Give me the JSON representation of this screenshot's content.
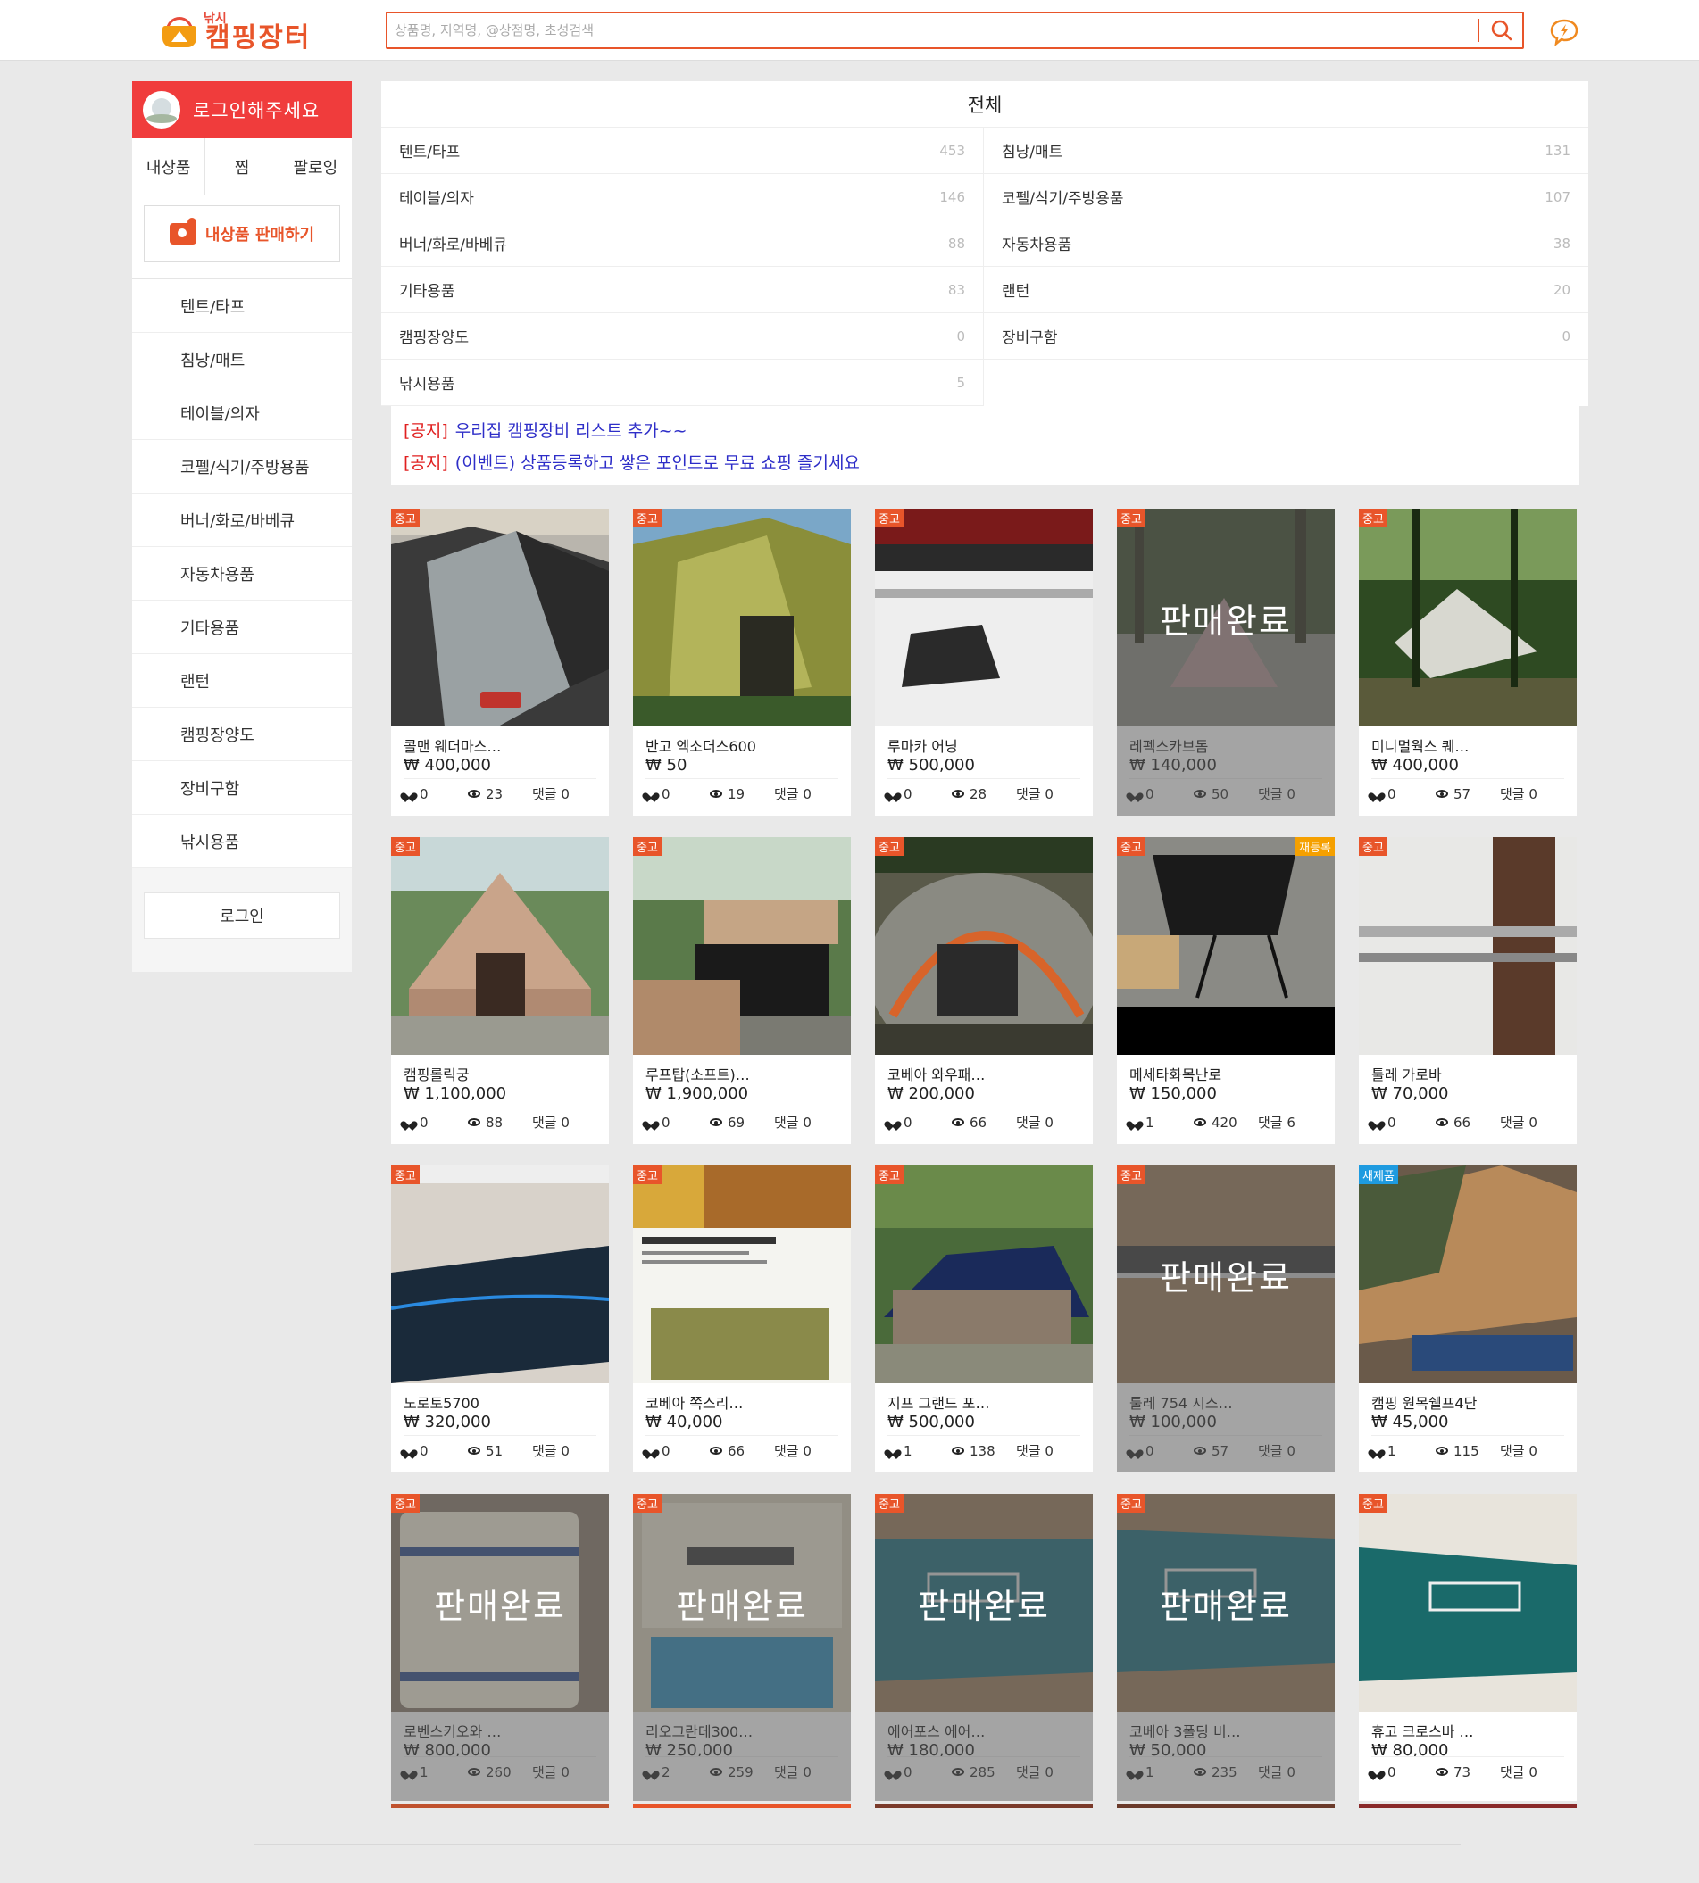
{
  "header": {
    "logo_small": "낚시",
    "logo_text": "캠핑장터",
    "search_placeholder": "상품명, 지역명, @상점명, 초성검색"
  },
  "sidebar": {
    "login_prompt": "로그인해주세요",
    "tabs": [
      "내상품",
      "찜",
      "팔로잉"
    ],
    "sell_button": "내상품 판매하기",
    "categories": [
      "텐트/타프",
      "침낭/매트",
      "테이블/의자",
      "코펠/식기/주방용품",
      "버너/화로/바베큐",
      "자동차용품",
      "기타용품",
      "랜턴",
      "캠핑장양도",
      "장비구함",
      "낚시용품"
    ],
    "login_button": "로그인"
  },
  "category_panel": {
    "title": "전체",
    "rows": [
      [
        {
          "name": "텐트/타프",
          "count": "453"
        },
        {
          "name": "침낭/매트",
          "count": "131"
        }
      ],
      [
        {
          "name": "테이블/의자",
          "count": "146"
        },
        {
          "name": "코펠/식기/주방용품",
          "count": "107"
        }
      ],
      [
        {
          "name": "버너/화로/바베큐",
          "count": "88"
        },
        {
          "name": "자동차용품",
          "count": "38"
        }
      ],
      [
        {
          "name": "기타용품",
          "count": "83"
        },
        {
          "name": "랜턴",
          "count": "20"
        }
      ],
      [
        {
          "name": "캠핑장양도",
          "count": "0"
        },
        {
          "name": "장비구함",
          "count": "0"
        }
      ],
      [
        {
          "name": "낚시용품",
          "count": "5"
        }
      ]
    ]
  },
  "notices": [
    {
      "tag": "[공지]",
      "text": "우리집 캠핑장비 리스트 추가~~"
    },
    {
      "tag": "[공지]",
      "text": "(이벤트) 상품등록하고 쌓은 포인트로 무료 쇼핑 즐기세요"
    }
  ],
  "labels": {
    "sold": "판매완료",
    "comment": "댓글",
    "used": "중고",
    "new": "새제품",
    "rereg": "재등록"
  },
  "products": [
    {
      "name": "콜맨 웨더마스…",
      "price": "₩ 400,000",
      "likes": "0",
      "views": "23",
      "comments": "0",
      "badge": "중고",
      "img": "tent1"
    },
    {
      "name": "반고 엑소더스600",
      "price": "₩ 50",
      "likes": "0",
      "views": "19",
      "comments": "0",
      "badge": "중고",
      "img": "tent2"
    },
    {
      "name": "루마카 어닝",
      "price": "₩ 500,000",
      "likes": "0",
      "views": "28",
      "comments": "0",
      "badge": "중고",
      "img": "car1"
    },
    {
      "name": "레펙스카브돔",
      "price": "₩ 140,000",
      "likes": "0",
      "views": "50",
      "comments": "0",
      "badge": "중고",
      "img": "forest",
      "sold": true
    },
    {
      "name": "미니멀웍스 퀘…",
      "price": "₩ 400,000",
      "likes": "0",
      "views": "57",
      "comments": "0",
      "badge": "중고",
      "img": "forest2"
    },
    {
      "name": "캠핑롤릭궁",
      "price": "₩ 1,100,000",
      "likes": "0",
      "views": "88",
      "comments": "0",
      "badge": "중고",
      "img": "bell"
    },
    {
      "name": "루프탑(소프트)…",
      "price": "₩ 1,900,000",
      "likes": "0",
      "views": "69",
      "comments": "0",
      "badge": "중고",
      "img": "roof"
    },
    {
      "name": "코베아 와우패…",
      "price": "₩ 200,000",
      "likes": "0",
      "views": "66",
      "comments": "0",
      "badge": "중고",
      "img": "dome"
    },
    {
      "name": "메세타화목난로",
      "price": "₩ 150,000",
      "likes": "1",
      "views": "420",
      "comments": "6",
      "badge": "중고",
      "badge2": "재등록",
      "img": "stove"
    },
    {
      "name": "툴레 가로바",
      "price": "₩ 70,000",
      "likes": "0",
      "views": "66",
      "comments": "0",
      "badge": "중고",
      "img": "bar"
    },
    {
      "name": "노로토5700",
      "price": "₩ 320,000",
      "likes": "0",
      "views": "51",
      "comments": "0",
      "badge": "중고",
      "img": "bag"
    },
    {
      "name": "코베아 쪽스리…",
      "price": "₩ 40,000",
      "likes": "0",
      "views": "66",
      "comments": "0",
      "badge": "중고",
      "img": "carpet"
    },
    {
      "name": "지프 그랜드 포…",
      "price": "₩ 500,000",
      "likes": "1",
      "views": "138",
      "comments": "0",
      "badge": "중고",
      "img": "tent3"
    },
    {
      "name": "툴레 754 시스…",
      "price": "₩ 100,000",
      "likes": "0",
      "views": "57",
      "comments": "0",
      "badge": "중고",
      "img": "floor",
      "sold": true
    },
    {
      "name": "캠핑 원목쉘프4단",
      "price": "₩ 45,000",
      "likes": "1",
      "views": "115",
      "comments": "0",
      "badge": "새제품",
      "badgeNew": true,
      "img": "shelf"
    },
    {
      "name": "로벤스키오와 …",
      "price": "₩ 800,000",
      "likes": "1",
      "views": "260",
      "comments": "0",
      "badge": "중고",
      "img": "bucket",
      "sold": true,
      "short": true
    },
    {
      "name": "리오그란데300…",
      "price": "₩ 250,000",
      "likes": "2",
      "views": "259",
      "comments": "0",
      "badge": "중고",
      "img": "box",
      "sold": true,
      "short": true
    },
    {
      "name": "에어포스 에어…",
      "price": "₩ 180,000",
      "likes": "0",
      "views": "285",
      "comments": "0",
      "badge": "중고",
      "img": "tealbag",
      "sold": true,
      "short": true
    },
    {
      "name": "코베아 3폴딩 비…",
      "price": "₩ 50,000",
      "likes": "1",
      "views": "235",
      "comments": "0",
      "badge": "중고",
      "img": "tealbag2",
      "sold": true,
      "short": true
    },
    {
      "name": "휴고 크로스바 …",
      "price": "₩ 80,000",
      "likes": "0",
      "views": "73",
      "comments": "0",
      "badge": "중고",
      "img": "tealbag3",
      "short": true
    }
  ]
}
